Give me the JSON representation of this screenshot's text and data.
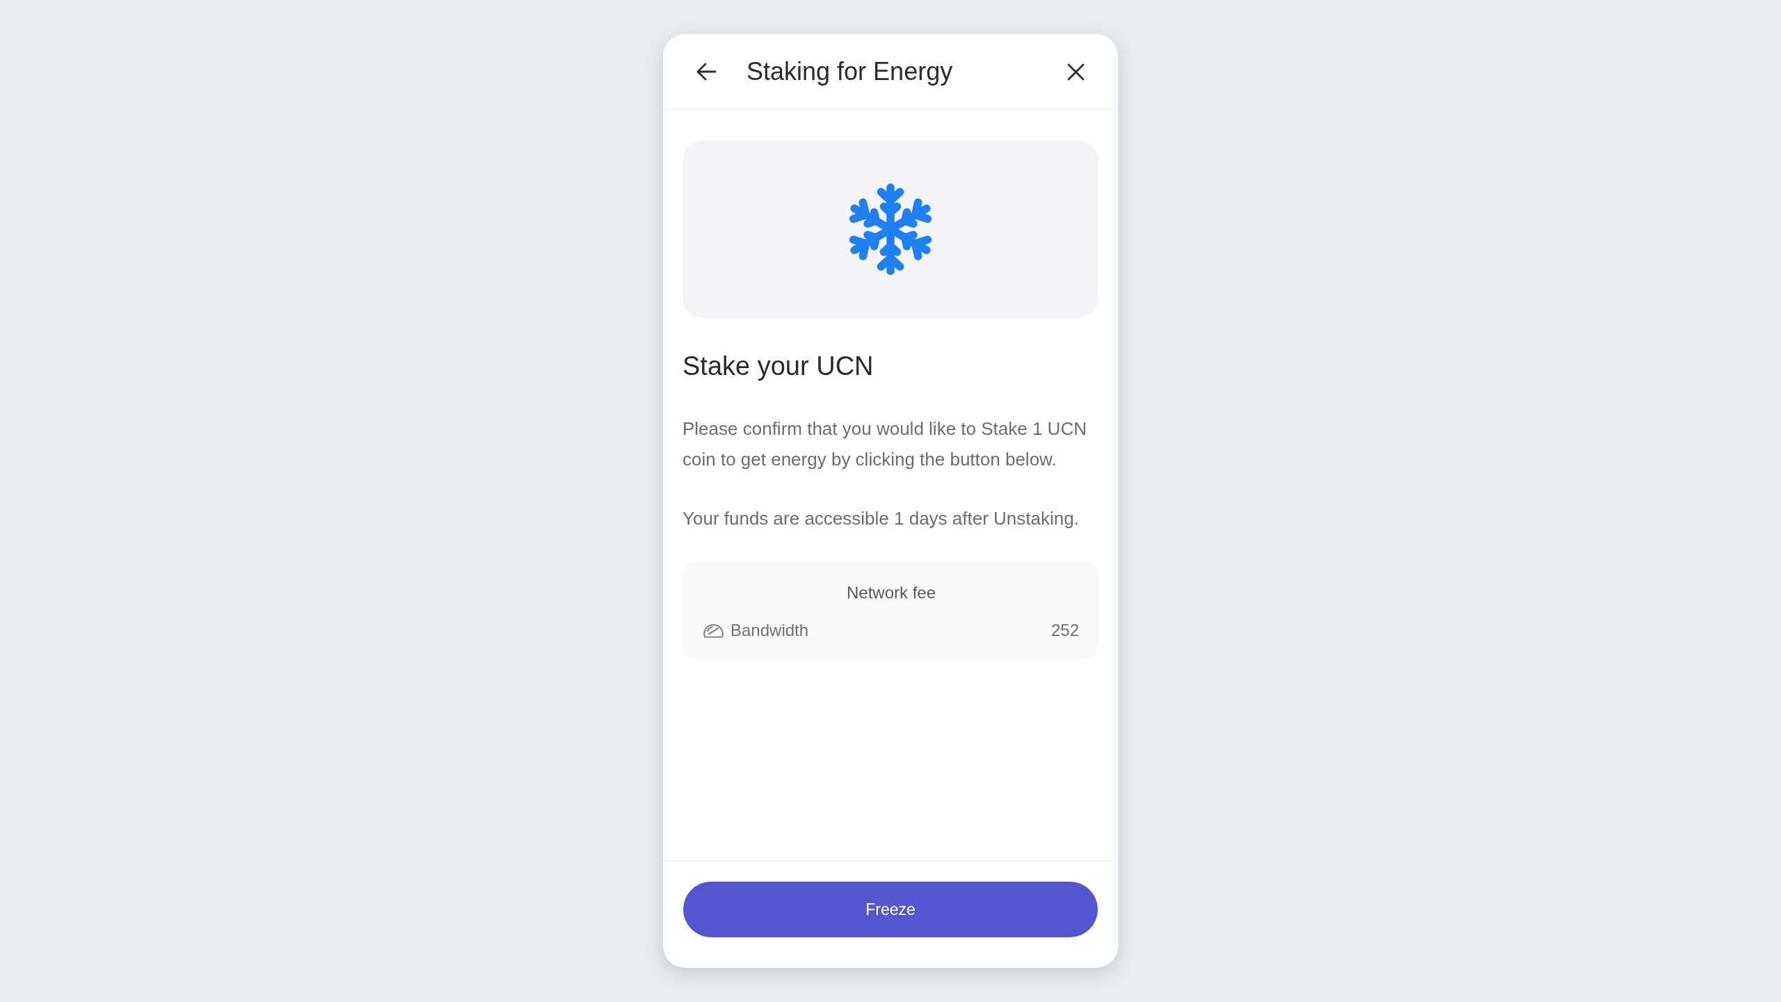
{
  "header": {
    "title": "Staking for Energy"
  },
  "heading": "Stake your UCN",
  "paragraphs": [
    "Please confirm that you would like to Stake 1 UCN coin to get energy by clicking the button below.",
    "Your funds are accessible 1 days after Unstaking."
  ],
  "fee": {
    "title": "Network fee",
    "rows": [
      {
        "label": "Bandwidth",
        "value": "252"
      }
    ]
  },
  "button": {
    "label": "Freeze"
  }
}
